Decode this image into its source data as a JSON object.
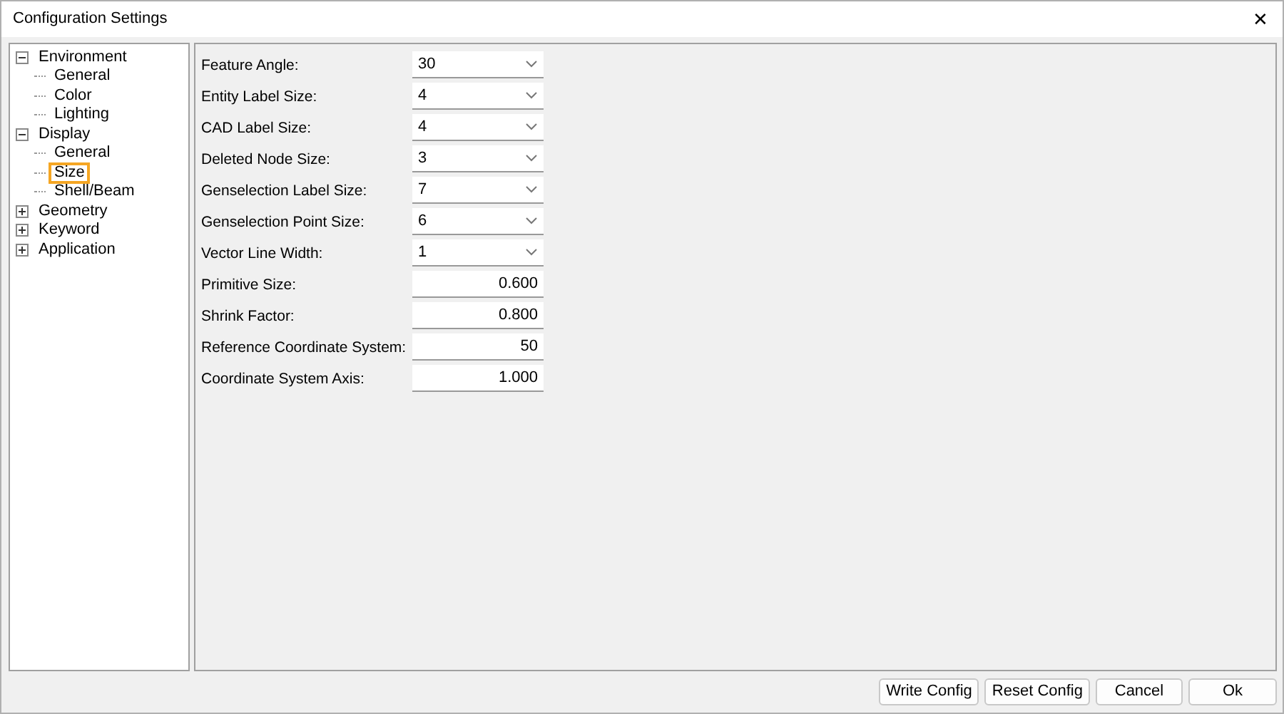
{
  "window": {
    "title": "Configuration Settings",
    "close": "✕"
  },
  "tree": [
    {
      "label": "Environment",
      "expanded": true,
      "selected": false,
      "children": [
        {
          "label": "General",
          "selected": false
        },
        {
          "label": "Color",
          "selected": false
        },
        {
          "label": "Lighting",
          "selected": false
        }
      ]
    },
    {
      "label": "Display",
      "expanded": true,
      "selected": false,
      "children": [
        {
          "label": "General",
          "selected": false
        },
        {
          "label": "Size",
          "selected": true
        },
        {
          "label": "Shell/Beam",
          "selected": false
        }
      ]
    },
    {
      "label": "Geometry",
      "expanded": false,
      "selected": false
    },
    {
      "label": "Keyword",
      "expanded": false,
      "selected": false
    },
    {
      "label": "Application",
      "expanded": false,
      "selected": false
    }
  ],
  "settings": [
    {
      "label": "Feature Angle:",
      "kind": "dropdown",
      "value": "30"
    },
    {
      "label": "Entity Label Size:",
      "kind": "dropdown",
      "value": "4"
    },
    {
      "label": "CAD Label Size:",
      "kind": "dropdown",
      "value": "4"
    },
    {
      "label": "Deleted Node Size:",
      "kind": "dropdown",
      "value": "3"
    },
    {
      "label": "Genselection Label Size:",
      "kind": "dropdown",
      "value": "7"
    },
    {
      "label": "Genselection Point Size:",
      "kind": "dropdown",
      "value": "6"
    },
    {
      "label": "Vector Line Width:",
      "kind": "dropdown",
      "value": "1"
    },
    {
      "label": "Primitive Size:",
      "kind": "number",
      "value": "0.600"
    },
    {
      "label": "Shrink Factor:",
      "kind": "number",
      "value": "0.800"
    },
    {
      "label": "Reference Coordinate System:",
      "kind": "number",
      "value": "50"
    },
    {
      "label": "Coordinate System Axis:",
      "kind": "number",
      "value": "1.000"
    }
  ],
  "buttons": [
    "Write Config",
    "Reset Config",
    "Cancel",
    "Ok"
  ]
}
